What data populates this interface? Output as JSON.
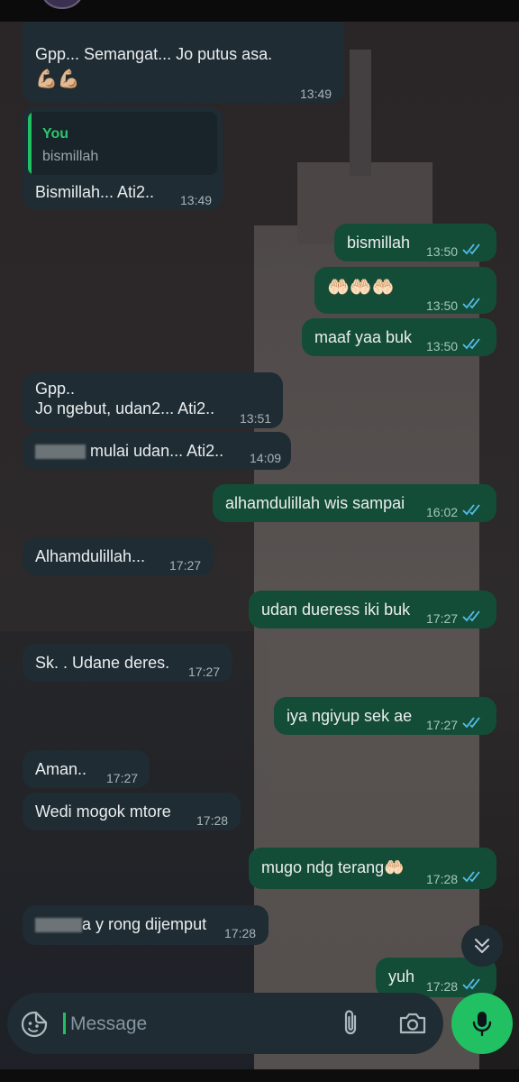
{
  "colors": {
    "incoming_bubble": "#1f2c33",
    "outgoing_bubble": "#144d37",
    "accent_green": "#21c063",
    "read_ticks": "#53bdeb"
  },
  "messages": [
    {
      "id": "m1",
      "dir": "in",
      "text": "Gpp... Semangat... Jo putus asa.",
      "extra": "💪🏼💪🏼",
      "time": "13:49"
    },
    {
      "id": "m2",
      "dir": "in",
      "quote_name": "You",
      "quote_text": "bismillah",
      "text": "Bismillah... Ati2..",
      "time": "13:49"
    },
    {
      "id": "m3",
      "dir": "out",
      "text": "bismillah",
      "time": "13:50",
      "status": "read"
    },
    {
      "id": "m4",
      "dir": "out",
      "text": "🤲🏻🤲🏻🤲🏻",
      "time": "13:50",
      "status": "read"
    },
    {
      "id": "m5",
      "dir": "out",
      "text": "maaf yaa buk",
      "time": "13:50",
      "status": "read"
    },
    {
      "id": "m6",
      "dir": "in",
      "text": "Gpp..\nJo ngebut, udan2... Ati2..",
      "time": "13:51"
    },
    {
      "id": "m7",
      "dir": "in",
      "text": "mulai udan... Ati2..",
      "time": "14:09",
      "redacted_prefix": true
    },
    {
      "id": "m8",
      "dir": "out",
      "text": "alhamdulillah wis sampai",
      "time": "16:02",
      "status": "read"
    },
    {
      "id": "m9",
      "dir": "in",
      "text": "Alhamdulillah...",
      "time": "17:27"
    },
    {
      "id": "m10",
      "dir": "out",
      "text": "udan dueress iki buk",
      "time": "17:27",
      "status": "read"
    },
    {
      "id": "m11",
      "dir": "in",
      "text": "Sk. . Udane deres.",
      "time": "17:27"
    },
    {
      "id": "m12",
      "dir": "out",
      "text": "iya ngiyup sek ae",
      "time": "17:27",
      "status": "read"
    },
    {
      "id": "m13",
      "dir": "in",
      "text": "Aman..",
      "time": "17:27"
    },
    {
      "id": "m14",
      "dir": "in",
      "text": "Wedi mogok mtore",
      "time": "17:28"
    },
    {
      "id": "m15",
      "dir": "out",
      "text": "mugo ndg terang🤲🏻",
      "time": "17:28",
      "status": "read"
    },
    {
      "id": "m16",
      "dir": "in",
      "text": "a y rong dijemput",
      "time": "17:28",
      "redacted_prefix": true
    },
    {
      "id": "m17",
      "dir": "out",
      "text": "yuh",
      "time": "17:28",
      "status": "read"
    }
  ],
  "composer": {
    "placeholder": "Message",
    "emoji_icon": "sticker-icon",
    "attach_icon": "paperclip-icon",
    "camera_icon": "camera-icon",
    "mic_icon": "microphone-icon"
  },
  "scroll_button": {
    "icon": "double-chevron-down-icon"
  }
}
